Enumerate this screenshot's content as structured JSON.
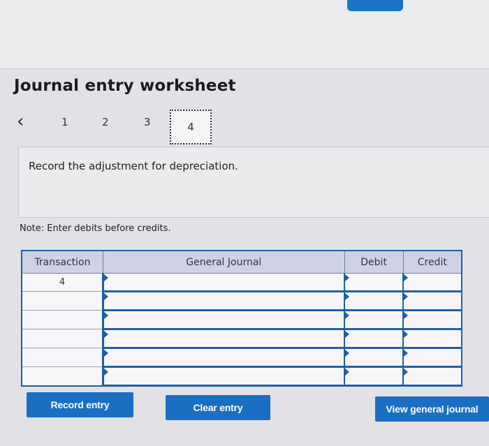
{
  "worksheet": {
    "title": "Journal entry worksheet",
    "prev_icon": "chevron-left-icon",
    "steps": [
      "1",
      "2",
      "3",
      "4"
    ],
    "active_step": "4",
    "instruction": "Record the adjustment for depreciation.",
    "note": "Note: Enter debits before credits."
  },
  "table": {
    "headers": {
      "transaction": "Transaction",
      "general_journal": "General Journal",
      "debit": "Debit",
      "credit": "Credit"
    },
    "rows": [
      {
        "transaction": "4",
        "account": "",
        "debit": "",
        "credit": ""
      },
      {
        "transaction": "",
        "account": "",
        "debit": "",
        "credit": ""
      },
      {
        "transaction": "",
        "account": "",
        "debit": "",
        "credit": ""
      },
      {
        "transaction": "",
        "account": "",
        "debit": "",
        "credit": ""
      },
      {
        "transaction": "",
        "account": "",
        "debit": "",
        "credit": ""
      },
      {
        "transaction": "",
        "account": "",
        "debit": "",
        "credit": ""
      }
    ]
  },
  "buttons": {
    "record": "Record entry",
    "clear": "Clear entry",
    "view": "View general journal"
  },
  "colors": {
    "accent": "#1a6fc4",
    "header_bg": "#cfd2e6"
  }
}
